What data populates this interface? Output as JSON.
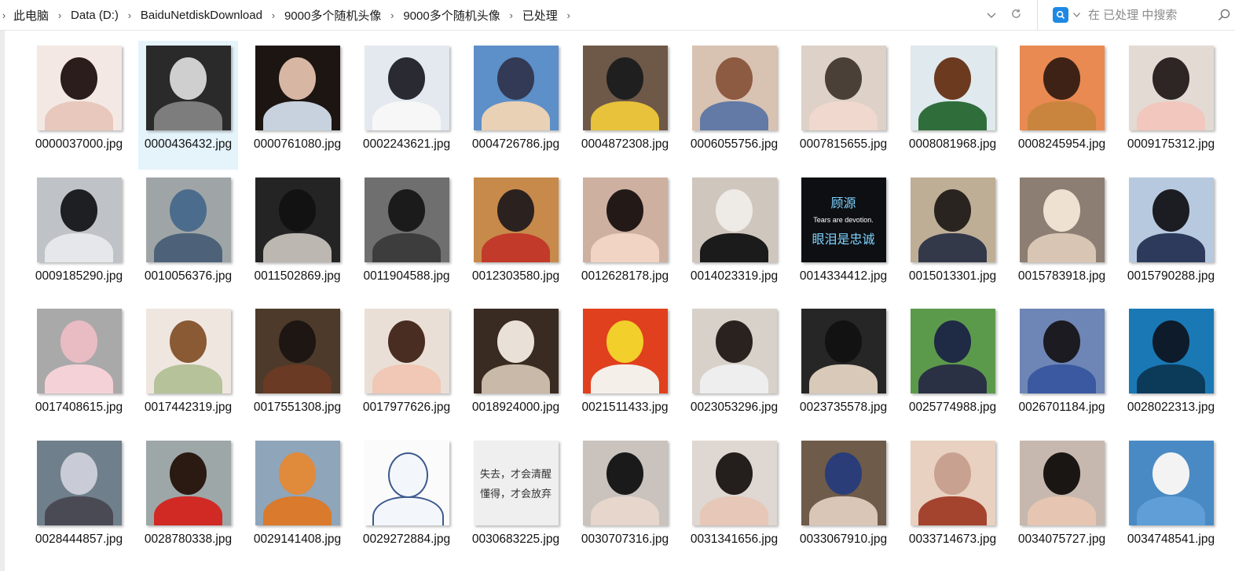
{
  "breadcrumb": [
    "此电脑",
    "Data (D:)",
    "BaiduNetdiskDownload",
    "9000多个随机头像",
    "9000多个随机头像",
    "已处理"
  ],
  "search": {
    "placeholder": "在 已处理 中搜索"
  },
  "selected_index": 1,
  "files": [
    {
      "name": "0000037000.jpg",
      "bg": "#f3e8e4",
      "head": "#2b1d1c",
      "body": "#e8c8bc"
    },
    {
      "name": "0000436432.jpg",
      "bg": "#2a2a2a",
      "head": "#cfcfcf",
      "body": "#7d7d7d"
    },
    {
      "name": "0000761080.jpg",
      "bg": "#1c1512",
      "head": "#d8b6a4",
      "body": "#c7d2de"
    },
    {
      "name": "0002243621.jpg",
      "bg": "#e4e9f0",
      "head": "#2a2a33",
      "body": "#f7f7f7"
    },
    {
      "name": "0004726786.jpg",
      "bg": "#5d8fc8",
      "head": "#333a55",
      "body": "#e9d1b5"
    },
    {
      "name": "0004872308.jpg",
      "bg": "#6e5848",
      "head": "#1f1f1f",
      "body": "#e7c23a"
    },
    {
      "name": "0006055756.jpg",
      "bg": "#d8c2b1",
      "head": "#8d5a42",
      "body": "#627aa5"
    },
    {
      "name": "0007815655.jpg",
      "bg": "#ddd1c8",
      "head": "#4a4038",
      "body": "#f0d8cf"
    },
    {
      "name": "0008081968.jpg",
      "bg": "#dfe9ee",
      "head": "#6c3a1f",
      "body": "#2f6e3b"
    },
    {
      "name": "0008245954.jpg",
      "bg": "#e88a52",
      "head": "#3e2216",
      "body": "#c9853d"
    },
    {
      "name": "0009175312.jpg",
      "bg": "#e3dad4",
      "head": "#2e2624",
      "body": "#f2c7bd"
    },
    {
      "name": "0009185290.jpg",
      "bg": "#bfc3c8",
      "head": "#1d1f22",
      "body": "#e5e7ea"
    },
    {
      "name": "0010056376.jpg",
      "bg": "#9fa5a6",
      "head": "#4c6c8d",
      "body": "#4d6279"
    },
    {
      "name": "0011502869.jpg",
      "bg": "#242424",
      "head": "#121212",
      "body": "#bdb7b2"
    },
    {
      "name": "0011904588.jpg",
      "bg": "#6f6f6f",
      "head": "#1b1b1b",
      "body": "#3d3d3d"
    },
    {
      "name": "0012303580.jpg",
      "bg": "#c78a4a",
      "head": "#2b2220",
      "body": "#c23a2a"
    },
    {
      "name": "0012628178.jpg",
      "bg": "#cdb0a0",
      "head": "#231a18",
      "body": "#f2d4c4"
    },
    {
      "name": "0014023319.jpg",
      "bg": "#cfc6bd",
      "head": "#eeeae6",
      "body": "#1b1b1b"
    },
    {
      "name": "0014334412.jpg",
      "bg": "#0d0f12",
      "head": "#0d0f12",
      "body": "#0d0f12",
      "text": [
        "顾源",
        "Tears are devotion.",
        "眼泪是忠诚"
      ]
    },
    {
      "name": "0015013301.jpg",
      "bg": "#bfae96",
      "head": "#2a2420",
      "body": "#34394a"
    },
    {
      "name": "0015783918.jpg",
      "bg": "#8c7e72",
      "head": "#efe1d2",
      "body": "#d8c5b4"
    },
    {
      "name": "0015790288.jpg",
      "bg": "#b7c9de",
      "head": "#1c1d22",
      "body": "#2d3a5c"
    },
    {
      "name": "0017408615.jpg",
      "bg": "#a9a9a9",
      "head": "#e9bcc4",
      "body": "#f4d1d6"
    },
    {
      "name": "0017442319.jpg",
      "bg": "#f0e6e0",
      "head": "#8a5a35",
      "body": "#b6c29a"
    },
    {
      "name": "0017551308.jpg",
      "bg": "#4d3a2a",
      "head": "#1d1613",
      "body": "#6a3a24"
    },
    {
      "name": "0017977626.jpg",
      "bg": "#eadfd6",
      "head": "#4a2d22",
      "body": "#f1c7b5"
    },
    {
      "name": "0018924000.jpg",
      "bg": "#3a2b22",
      "head": "#e9e1d7",
      "body": "#c9b9a8"
    },
    {
      "name": "0021511433.jpg",
      "bg": "#e0401e",
      "head": "#f2cf2a",
      "body": "#f4efe8"
    },
    {
      "name": "0023053296.jpg",
      "bg": "#d8d1ca",
      "head": "#2a221e",
      "body": "#eeeeee"
    },
    {
      "name": "0023735578.jpg",
      "bg": "#262626",
      "head": "#121212",
      "body": "#d8c9b9"
    },
    {
      "name": "0025774988.jpg",
      "bg": "#5c9a4b",
      "head": "#1f2a44",
      "body": "#2b3144"
    },
    {
      "name": "0026701184.jpg",
      "bg": "#6e86b5",
      "head": "#1c1b22",
      "body": "#3b59a0"
    },
    {
      "name": "0028022313.jpg",
      "bg": "#1a78b5",
      "head": "#0d1b2a",
      "body": "#0c3b5a"
    },
    {
      "name": "0028444857.jpg",
      "bg": "#6f7f8c",
      "head": "#c9ccd6",
      "body": "#4a4a55"
    },
    {
      "name": "0028780338.jpg",
      "bg": "#9da7a8",
      "head": "#2a1a12",
      "body": "#d12a24"
    },
    {
      "name": "0029141408.jpg",
      "bg": "#8fa5ba",
      "head": "#e08a3c",
      "body": "#d97a2c"
    },
    {
      "name": "0029272884.jpg",
      "bg": "#fbfbfb",
      "head": "#f3f6fb",
      "body": "#f3f6fb",
      "line": "#3c5a8c"
    },
    {
      "name": "0030683225.jpg",
      "bg": "#efefef",
      "head": "#efefef",
      "body": "#efefef",
      "text": [
        "失去，才会清醒",
        "懂得，才会放弃"
      ],
      "dark": true
    },
    {
      "name": "0030707316.jpg",
      "bg": "#c9c2bd",
      "head": "#1a1a1a",
      "body": "#e7d6cc"
    },
    {
      "name": "0031341656.jpg",
      "bg": "#ded7d2",
      "head": "#241e1c",
      "body": "#e7c7b7"
    },
    {
      "name": "0033067910.jpg",
      "bg": "#6e5b4a",
      "head": "#2a3d78",
      "body": "#d9c6b6"
    },
    {
      "name": "0033714673.jpg",
      "bg": "#e8d1c1",
      "head": "#c9a191",
      "body": "#a4442f"
    },
    {
      "name": "0034075727.jpg",
      "bg": "#c6b8ae",
      "head": "#1a1614",
      "body": "#e6c6b2"
    },
    {
      "name": "0034748541.jpg",
      "bg": "#4a8ac4",
      "head": "#f3f3f3",
      "body": "#5f9ed6"
    }
  ]
}
